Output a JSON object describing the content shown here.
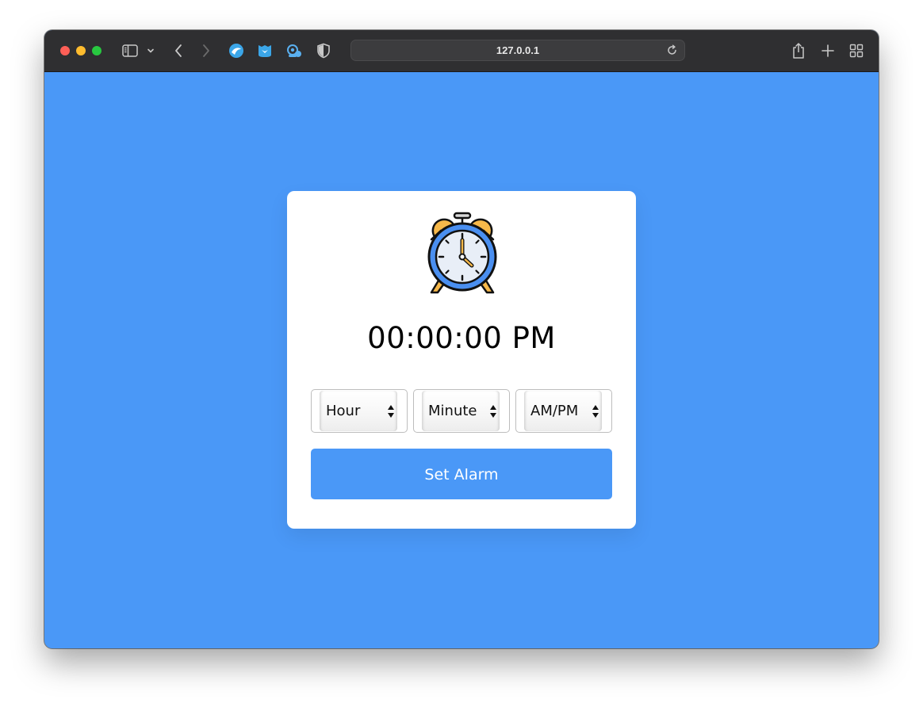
{
  "browser": {
    "address": "127.0.0.1",
    "icons": [
      "sidebar-toggle-icon",
      "chevron-down-icon",
      "back-arrow-icon",
      "forward-arrow-icon",
      "extension-blue-icon",
      "extension-shield-icon",
      "extension-cloud-icon",
      "privacy-shield-icon",
      "reload-icon",
      "share-icon",
      "new-tab-icon",
      "tab-overview-icon"
    ]
  },
  "alarm": {
    "time_display": "00:00:00 PM",
    "hour_select": "Hour",
    "minute_select": "Minute",
    "ampm_select": "AM/PM",
    "set_button": "Set Alarm"
  },
  "colors": {
    "accent": "#4a98f7",
    "card": "#ffffff",
    "toolbar": "#2f2f31"
  }
}
